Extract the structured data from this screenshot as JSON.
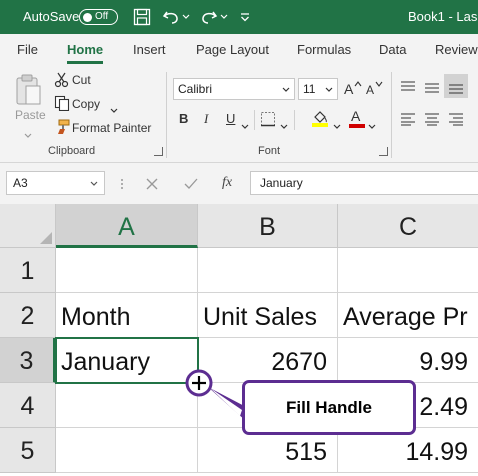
{
  "titlebar": {
    "autosave_label": "AutoSave",
    "autosave_state": "Off",
    "title": "Book1 - Las"
  },
  "tabs": [
    "File",
    "Home",
    "Insert",
    "Page Layout",
    "Formulas",
    "Data",
    "Review"
  ],
  "ribbon": {
    "paste_label": "Paste",
    "cut_label": "Cut",
    "copy_label": "Copy",
    "format_painter_label": "Format Painter",
    "clipboard_group": "Clipboard",
    "font_name": "Calibri",
    "font_size": "11",
    "bold": "B",
    "italic": "I",
    "underline": "U",
    "font_color_glyph": "A",
    "font_group": "Font",
    "highlight_color": "#ffff00",
    "font_color": "#d00000"
  },
  "formula_bar": {
    "name_box": "A3",
    "fx": "fx",
    "content": "January"
  },
  "grid": {
    "columns": [
      "A",
      "B",
      "C"
    ],
    "rows": [
      "1",
      "2",
      "3",
      "4",
      "5"
    ],
    "cells": {
      "a2": "Month",
      "b2": "Unit Sales",
      "c2": "Average Pr",
      "a3": "January",
      "b3": "2670",
      "c3": "9.99",
      "c4": "2.49",
      "b5": "515",
      "c5": "14.99"
    }
  },
  "callout": {
    "label": "Fill Handle",
    "color": "#5c2d91"
  },
  "colors": {
    "brand": "#217346",
    "selection": "#217346"
  }
}
